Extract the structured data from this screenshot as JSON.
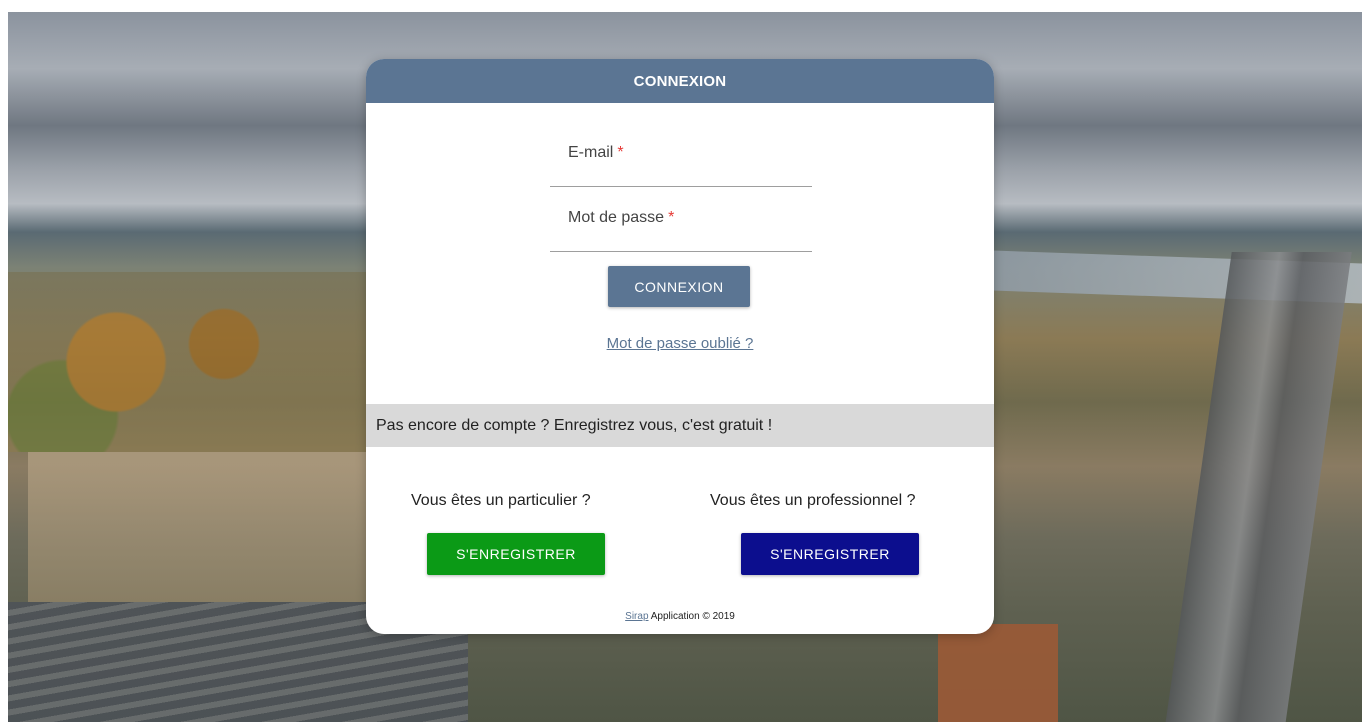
{
  "login": {
    "header_title": "CONNEXION",
    "email_label": "E-mail",
    "password_label": "Mot de passe",
    "required_mark": "*",
    "email_value": "",
    "password_value": "",
    "login_button": "CONNEXION",
    "forgot_link": "Mot de passe oublié ?"
  },
  "register": {
    "banner": "Pas encore de compte ? Enregistrez vous, c'est gratuit !",
    "individual_title": "Vous êtes un particulier ?",
    "individual_button": "S'ENREGISTRER",
    "professional_title": "Vous êtes un professionnel ?",
    "professional_button": "S'ENREGISTRER"
  },
  "footer": {
    "link": "Sirap",
    "text": "Application © 2019"
  },
  "colors": {
    "header": "#5b7593",
    "individual_button": "#0b9a16",
    "professional_button": "#0c0e8e",
    "required": "#e53935"
  }
}
